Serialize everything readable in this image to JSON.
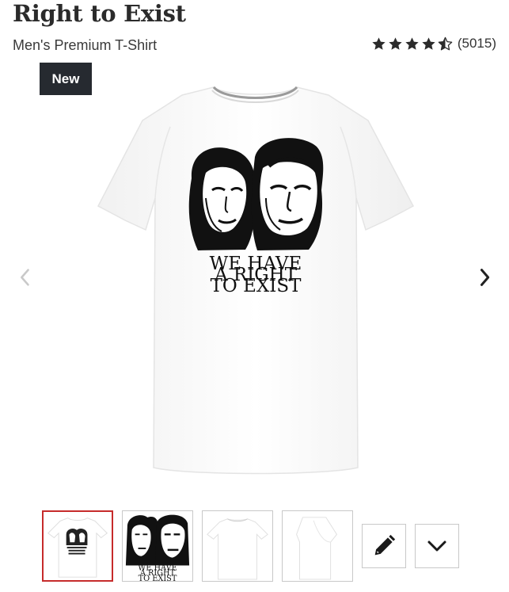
{
  "product": {
    "title": "Right to Exist",
    "subtitle": "Men's Premium T-Shirt",
    "badge": "New",
    "rating_stars": 4.5,
    "rating_count": "(5015)",
    "print_text_lines": [
      "WE HAVE",
      "A RIGHT",
      "TO EXIST"
    ]
  },
  "gallery": {
    "selected_index": 0,
    "thumbnails": [
      "front-view",
      "design-closeup",
      "back-view",
      "side-view"
    ]
  },
  "icons": {
    "prev": "chevron-left-icon",
    "next": "chevron-right-icon",
    "edit": "pencil-icon",
    "expand": "chevron-down-icon"
  },
  "colors": {
    "badge_bg": "#262a30",
    "selected_border": "#c62b2b",
    "text": "#2b2b2b"
  }
}
